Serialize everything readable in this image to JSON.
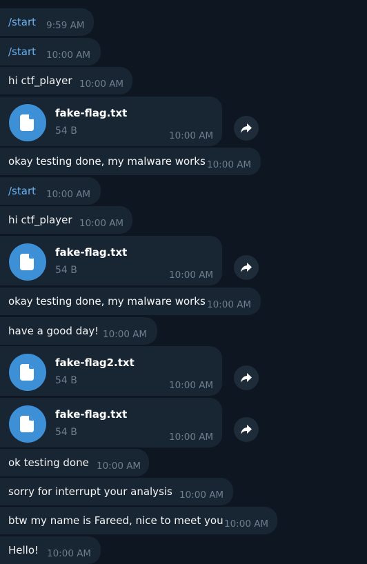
{
  "messages": [
    {
      "kind": "command",
      "text": "/start",
      "time": "9:59 AM"
    },
    {
      "kind": "command",
      "text": "/start",
      "time": "10:00 AM"
    },
    {
      "kind": "text",
      "text": "hi ctf_player",
      "time": "10:00 AM"
    },
    {
      "kind": "file",
      "name": "fake-flag.txt",
      "size": "54 B",
      "time": "10:00 AM",
      "icon": "file-icon",
      "share_icon": "share-arrow-icon"
    },
    {
      "kind": "text",
      "text": "okay testing done, my malware works",
      "time": "10:00 AM"
    },
    {
      "kind": "command",
      "text": "/start",
      "time": "10:00 AM"
    },
    {
      "kind": "text",
      "text": "hi ctf_player",
      "time": "10:00 AM"
    },
    {
      "kind": "file",
      "name": "fake-flag.txt",
      "size": "54 B",
      "time": "10:00 AM",
      "icon": "file-icon",
      "share_icon": "share-arrow-icon"
    },
    {
      "kind": "text",
      "text": "okay testing done, my malware works",
      "time": "10:00 AM"
    },
    {
      "kind": "text",
      "text": "have a good day!",
      "time": "10:00 AM"
    },
    {
      "kind": "file",
      "name": "fake-flag2.txt",
      "size": "54 B",
      "time": "10:00 AM",
      "icon": "file-icon",
      "share_icon": "share-arrow-icon"
    },
    {
      "kind": "file",
      "name": "fake-flag.txt",
      "size": "54 B",
      "time": "10:00 AM",
      "icon": "file-icon",
      "share_icon": "share-arrow-icon"
    },
    {
      "kind": "text",
      "text": "ok testing done",
      "time": "10:00 AM"
    },
    {
      "kind": "text",
      "text": "sorry for interrupt your analysis",
      "time": "10:00 AM"
    },
    {
      "kind": "text",
      "text": "btw my name is Fareed, nice to meet you",
      "time": "10:00 AM"
    },
    {
      "kind": "text",
      "text": "Hello!",
      "time": "10:00 AM"
    }
  ],
  "colors": {
    "background": "#0e1621",
    "bubble": "#182533",
    "command": "#6ab3f3",
    "time": "#6d7f8f",
    "file_icon": "#3d8fd6"
  }
}
